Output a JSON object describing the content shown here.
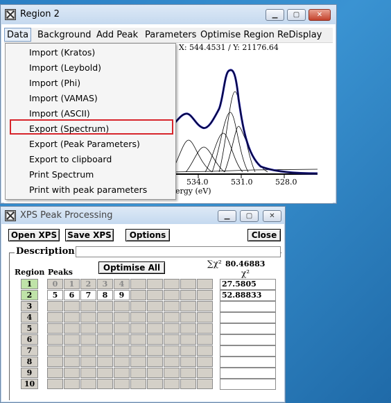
{
  "region_window": {
    "title": "Region 2",
    "menu": [
      "Data",
      "Background",
      "Add Peak",
      "Parameters",
      "Optimise Region",
      "ReDisplay"
    ],
    "coord_readout": "X: 544.4531 / Y: 21176.64",
    "x_ticks": [
      "534.0",
      "531.0",
      "528.0"
    ],
    "x_label_partial": "ergy (eV)",
    "data_menu_items": [
      "Import (Kratos)",
      "Import (Leybold)",
      "Import (Phi)",
      "Import (VAMAS)",
      "Import (ASCII)",
      "Export (Spectrum)",
      "Export (Peak Parameters)",
      "Export to clipboard",
      "Print Spectrum",
      "Print with peak parameters"
    ],
    "highlighted_item": "Export (Spectrum)",
    "colors": {
      "spectrum": "#1a1aa0",
      "envelope": "#000000",
      "highlight_box": "#d7252b"
    }
  },
  "xps_window": {
    "title": "XPS Peak Processing",
    "buttons": {
      "open": "Open XPS",
      "save": "Save XPS",
      "options": "Options",
      "close": "Close",
      "optimise_all": "Optimise All"
    },
    "description_label": "Description",
    "description_value": "",
    "region_header": "Region",
    "peaks_header": "Peaks",
    "sum_chi_label": "∑χ²",
    "sum_chi_value": "80.46883",
    "chi_label": "χ²",
    "regions": [
      "1",
      "2",
      "3",
      "4",
      "5",
      "6",
      "7",
      "8",
      "9",
      "10"
    ],
    "selected_region": "2",
    "peak_rows": [
      [
        "0",
        "1",
        "2",
        "3",
        "4"
      ],
      [
        "5",
        "6",
        "7",
        "8",
        "9"
      ]
    ],
    "chi_values": [
      "27.5805",
      "52.88833"
    ]
  }
}
